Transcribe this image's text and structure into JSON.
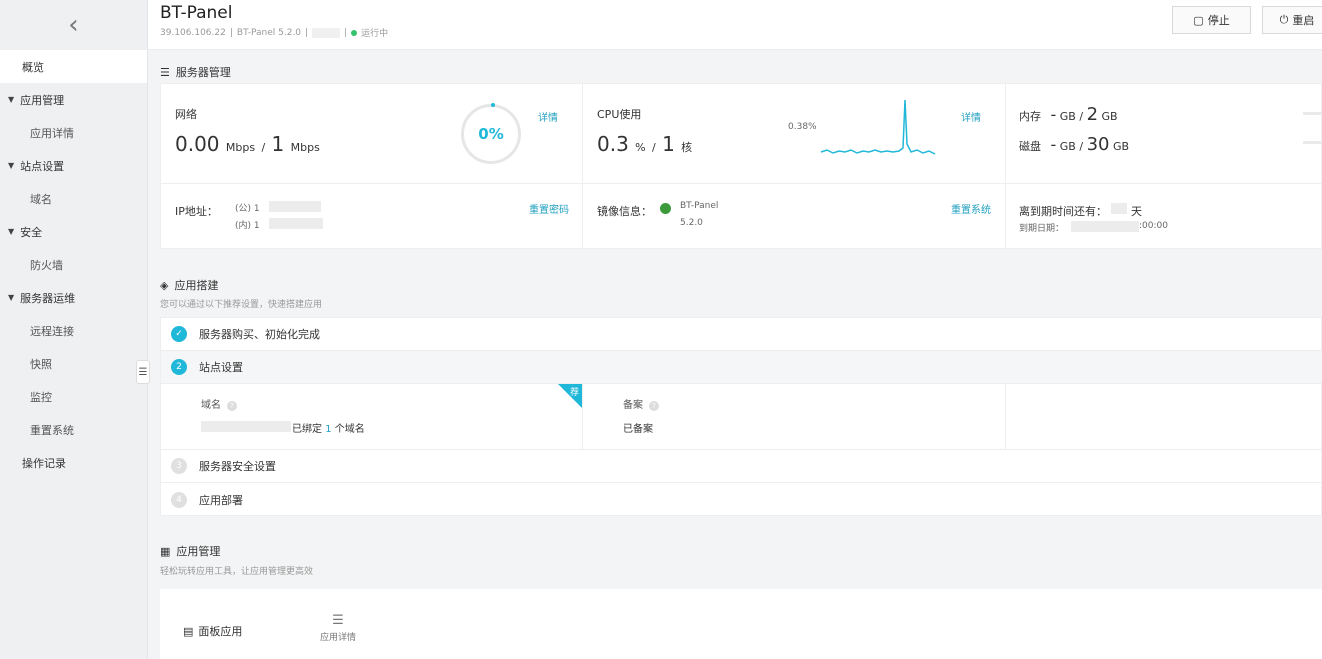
{
  "sidebar": {
    "back_icon": "chevron-left-icon",
    "items": [
      {
        "label": "概览",
        "type": "item",
        "active": true
      },
      {
        "label": "应用管理",
        "type": "group"
      },
      {
        "label": "应用详情",
        "type": "sub"
      },
      {
        "label": "站点设置",
        "type": "group"
      },
      {
        "label": "域名",
        "type": "sub"
      },
      {
        "label": "安全",
        "type": "group"
      },
      {
        "label": "防火墙",
        "type": "sub"
      },
      {
        "label": "服务器运维",
        "type": "group"
      },
      {
        "label": "远程连接",
        "type": "sub"
      },
      {
        "label": "快照",
        "type": "sub"
      },
      {
        "label": "监控",
        "type": "sub"
      },
      {
        "label": "重置系统",
        "type": "sub"
      },
      {
        "label": "操作记录",
        "type": "item"
      }
    ]
  },
  "header": {
    "title": "BT-Panel",
    "ip": "39.106.106.22",
    "image": "BT-Panel 5.2.0",
    "status": "运行中",
    "stop_label": "停止",
    "restart_label": "重启"
  },
  "server": {
    "section_title": "服务器管理",
    "network": {
      "label": "网络",
      "value_in": "0.00",
      "unit": "Mbps",
      "sep": "/",
      "value_total": "1",
      "unit2": "Mbps",
      "gauge": "0%",
      "detail": "详情"
    },
    "cpu": {
      "label": "CPU使用",
      "value": "0.3",
      "unit": "%",
      "sep": "/",
      "cores": "1",
      "unit2": "核",
      "peak": "0.38%",
      "detail": "详情"
    },
    "memory": {
      "label": "内存",
      "used": "-",
      "unit": "GB",
      "sep": "/",
      "total": "2",
      "unit2": "GB"
    },
    "disk": {
      "label": "磁盘",
      "used": "-",
      "unit": "GB",
      "sep": "/",
      "total": "30",
      "unit2": "GB"
    },
    "ip": {
      "label": "IP地址：",
      "public": "(公) 1",
      "private": "(内) 1",
      "reset_pwd": "重置密码"
    },
    "image": {
      "label": "镜像信息：",
      "name": "BT-Panel",
      "version": "5.2.0",
      "reset_sys": "重置系统"
    },
    "expire": {
      "label": "离到期时间还有：",
      "unit": "天",
      "date_label": "到期日期：",
      "date_tail": ":00:00"
    }
  },
  "build": {
    "section_title": "应用搭建",
    "section_sub": "您可以通过以下推荐设置，快速搭建应用",
    "steps": [
      {
        "num": "✓",
        "label": "服务器购买、初始化完成",
        "state": "done"
      },
      {
        "num": "2",
        "label": "站点设置",
        "state": "current"
      },
      {
        "num": "3",
        "label": "服务器安全设置",
        "state": "todo"
      },
      {
        "num": "4",
        "label": "应用部署",
        "state": "todo"
      }
    ],
    "domain_label": "域名",
    "domain_bound_prefix": "已绑定",
    "domain_count": "1",
    "domain_bound_suffix": "个域名",
    "ribbon": "荐",
    "beian_label": "备案",
    "beian_value": "已备案"
  },
  "apps": {
    "section_title": "应用管理",
    "section_sub": "轻松玩转应用工具，让应用管理更高效",
    "panel_app": "面板应用",
    "app_detail": "应用详情"
  },
  "colors": {
    "accent": "#20b8d8",
    "running": "#35c26b"
  }
}
